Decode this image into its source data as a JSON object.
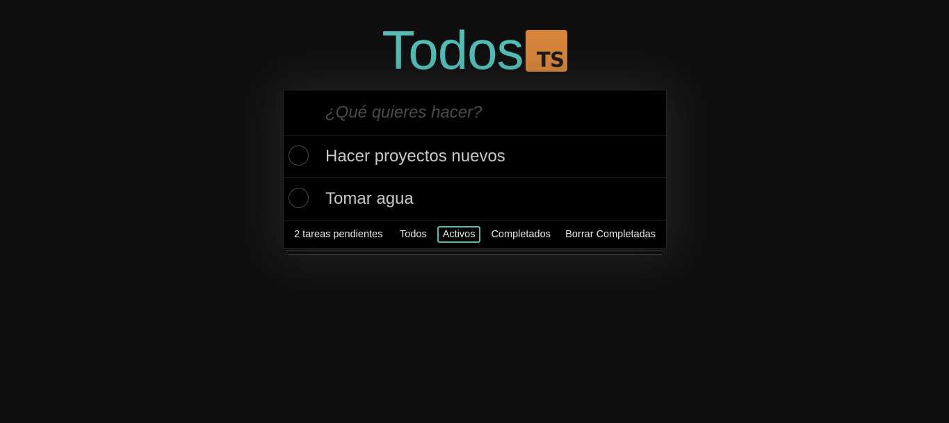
{
  "header": {
    "title": "Todos",
    "badge": "TS",
    "badge_color": "#d6853a",
    "title_color": "#4fc1b9"
  },
  "new_todo": {
    "placeholder": "¿Qué quieres hacer?",
    "value": ""
  },
  "todos": [
    {
      "label": "Hacer proyectos nuevos",
      "completed": false
    },
    {
      "label": "Tomar agua",
      "completed": false
    }
  ],
  "footer": {
    "count_text": "2 tareas pendientes",
    "filters": [
      {
        "label": "Todos",
        "selected": false
      },
      {
        "label": "Activos",
        "selected": true
      },
      {
        "label": "Completados",
        "selected": false
      }
    ],
    "clear_label": "Borrar Completadas"
  }
}
